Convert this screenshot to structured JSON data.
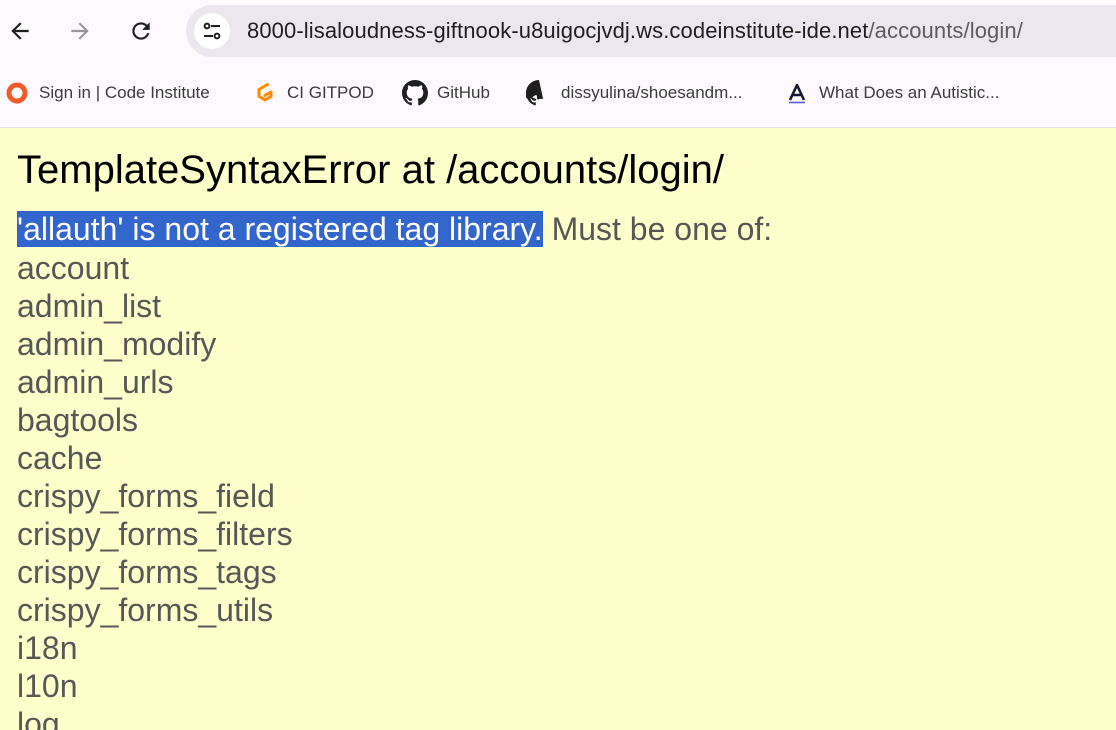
{
  "browser": {
    "url_host": "8000-lisaloudness-giftnook-u8uigocjvdj.ws.codeinstitute-ide.net",
    "url_path": "/accounts/login/"
  },
  "bookmarks": [
    {
      "label": "Sign in | Code Institute",
      "icon": "code-institute-icon"
    },
    {
      "label": "CI GITPOD",
      "icon": "gitpod-icon"
    },
    {
      "label": "GitHub",
      "icon": "github-icon"
    },
    {
      "label": "dissyulina/shoesandm...",
      "icon": "github-icon"
    },
    {
      "label": "What Does an Autistic...",
      "icon": "a-letter-icon"
    }
  ],
  "error": {
    "title": "TemplateSyntaxError at /accounts/login/",
    "message_highlighted": "'allauth' is not a registered tag library.",
    "message_rest": " Must be one of:",
    "libraries": [
      "account",
      "admin_list",
      "admin_modify",
      "admin_urls",
      "bagtools",
      "cache",
      "crispy_forms_field",
      "crispy_forms_filters",
      "crispy_forms_tags",
      "crispy_forms_utils",
      "i18n",
      "l10n",
      "log"
    ]
  },
  "colors": {
    "page_background": "#ffffcc",
    "selection_highlight": "#3366cc"
  }
}
